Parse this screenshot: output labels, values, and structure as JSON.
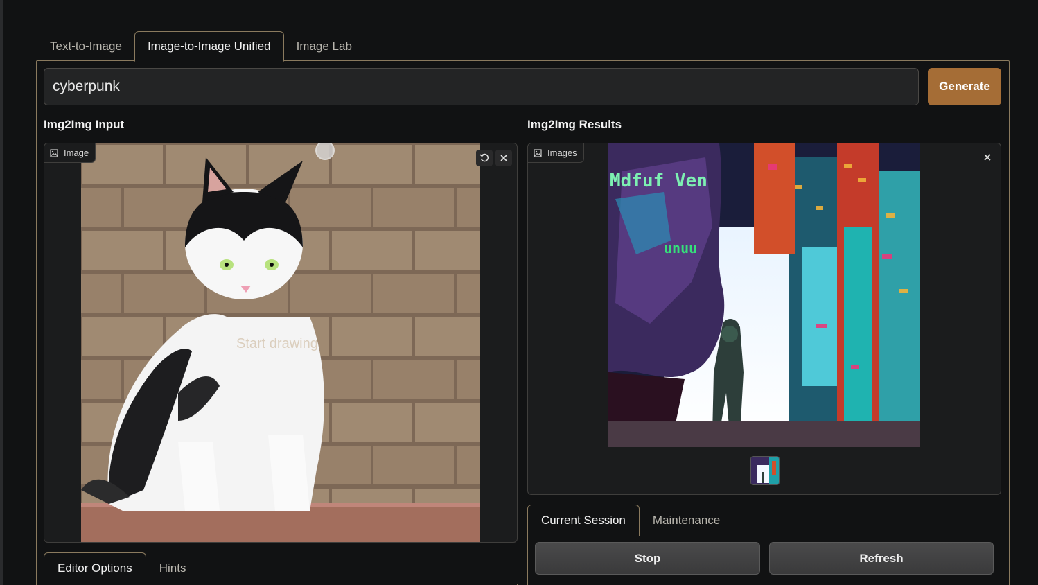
{
  "tabs": {
    "items": [
      "Text-to-Image",
      "Image-to-Image Unified",
      "Image Lab"
    ],
    "active": 1
  },
  "prompt": {
    "value": "cyberpunk"
  },
  "generate_label": "Generate",
  "input_section": {
    "title": "Img2Img Input",
    "chip_label": "Image",
    "canvas_hint": "Start drawing"
  },
  "results_section": {
    "title": "Img2Img Results",
    "chip_label": "Images",
    "overlay_text_1": "Mdfuf Ven",
    "overlay_text_2": "unuu"
  },
  "editor_tabs": {
    "items": [
      "Editor Options",
      "Hints"
    ],
    "active": 0
  },
  "session_tabs": {
    "items": [
      "Current Session",
      "Maintenance"
    ],
    "active": 0
  },
  "session_buttons": {
    "stop": "Stop",
    "refresh": "Refresh"
  },
  "colors": {
    "accent": "#a56d36",
    "border_accent": "#8a7a5e",
    "background": "#111213"
  }
}
